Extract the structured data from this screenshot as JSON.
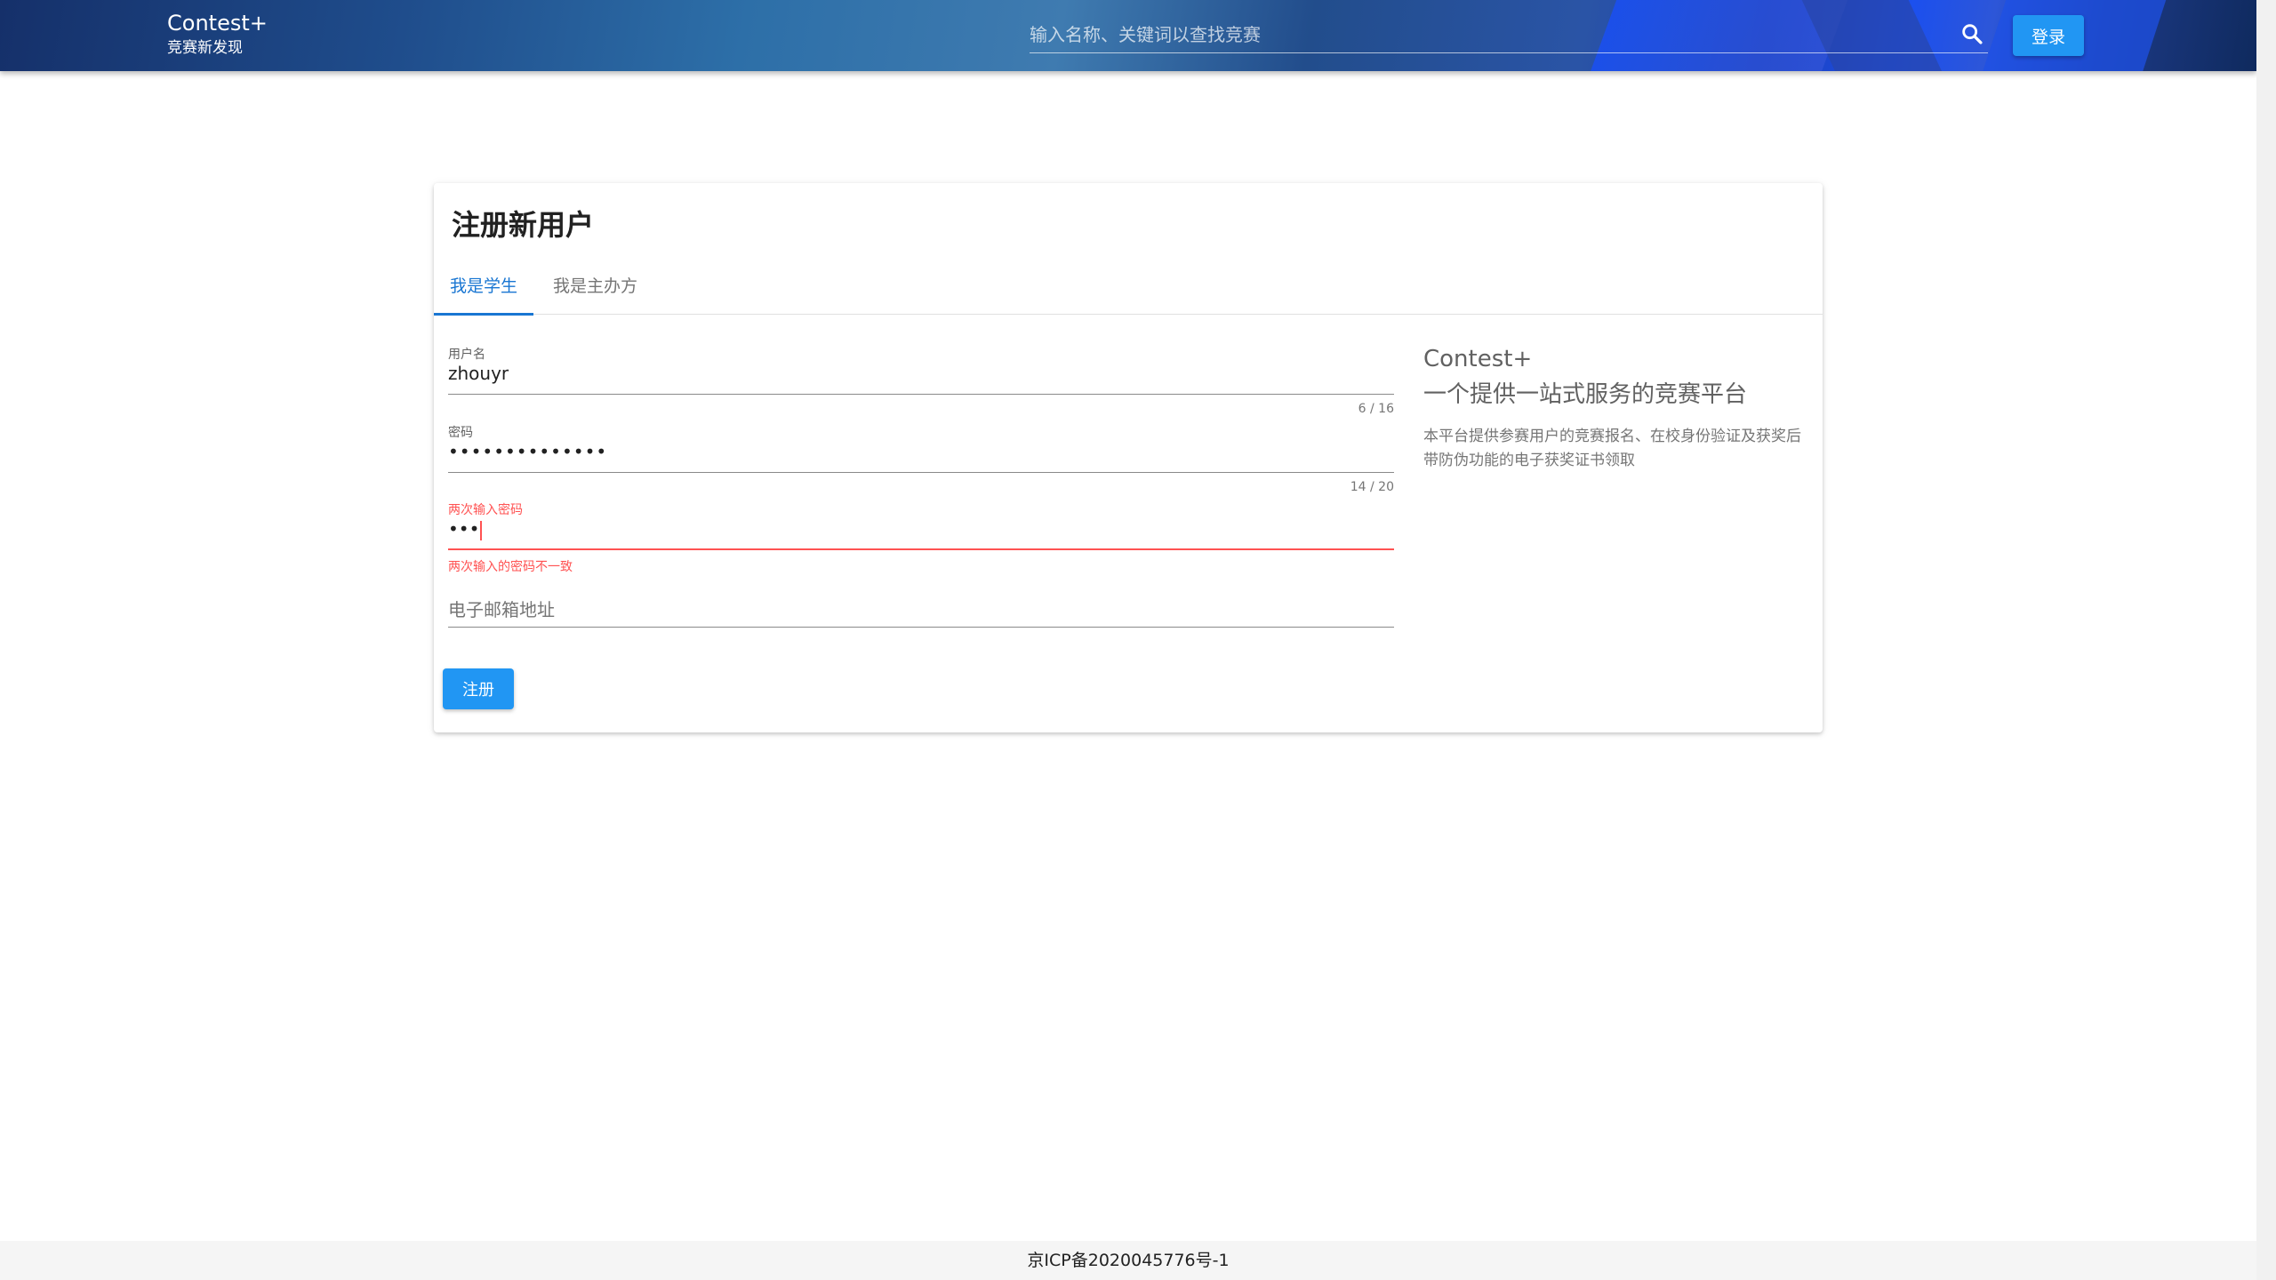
{
  "header": {
    "brand_title": "Contest+",
    "brand_subtitle": "竞赛新发现",
    "search_placeholder": "输入名称、关键词以查找竞赛",
    "login_label": "登录"
  },
  "card": {
    "title": "注册新用户",
    "tabs": [
      {
        "label": "我是学生",
        "active": true
      },
      {
        "label": "我是主办方",
        "active": false
      }
    ],
    "form": {
      "username": {
        "label": "用户名",
        "value": "zhouyr",
        "counter": "6 / 16"
      },
      "password": {
        "label": "密码",
        "value": "••••••••••••••",
        "counter": "14 / 20"
      },
      "confirm_password": {
        "label": "两次输入密码",
        "value": "•••",
        "error": "两次输入的密码不一致"
      },
      "email": {
        "placeholder": "电子邮箱地址",
        "value": ""
      },
      "submit_label": "注册"
    },
    "info": {
      "title": "Contest+",
      "subtitle": "一个提供一站式服务的竞赛平台",
      "description": "本平台提供参赛用户的竞赛报名、在校身份验证及获奖后带防伪功能的电子获奖证书领取"
    }
  },
  "footer": {
    "icp": "京ICP备2020045776号-1"
  },
  "colors": {
    "primary": "#2196f3",
    "tab_active": "#1976d2",
    "error": "#ff5252"
  },
  "icons": {
    "search": "search-icon"
  }
}
